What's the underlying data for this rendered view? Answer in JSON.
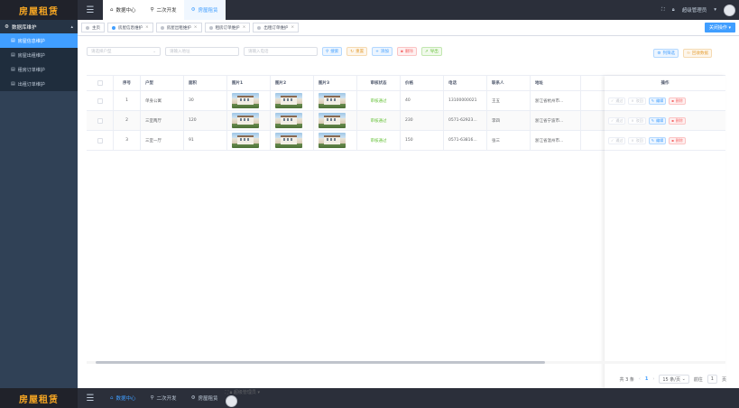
{
  "app": {
    "logo": "房屋租赁",
    "accent": "#409eff"
  },
  "topnav": {
    "tabs": [
      {
        "label": "数据中心",
        "icon": "home-icon"
      },
      {
        "label": "二次开发",
        "icon": "location-icon"
      },
      {
        "label": "房屋租赁",
        "icon": "gear-icon"
      }
    ],
    "user": "超级管理员"
  },
  "sidebar": {
    "group": "数据库维护",
    "items": [
      {
        "label": "房屋信息维护"
      },
      {
        "label": "房屋出租维护"
      },
      {
        "label": "租房订单维护"
      },
      {
        "label": "出租订单维护"
      }
    ]
  },
  "tags": {
    "items": [
      {
        "label": "主页"
      },
      {
        "label": "房屋信息维护"
      },
      {
        "label": "房屋出租维护"
      },
      {
        "label": "租房订单维护"
      },
      {
        "label": "出租订单维护"
      }
    ],
    "ops_label": "关闭操作"
  },
  "search": {
    "type_placeholder": "请选择户型",
    "address_placeholder": "请输入地址",
    "phone_placeholder": "请输入电话",
    "search_label": "搜索",
    "reset_label": "重置",
    "add_label": "添加",
    "delete_label": "删除",
    "export_label": "导出",
    "columns_label": "列筛选",
    "recycle_label": "回收数据"
  },
  "table": {
    "headers": [
      "序号",
      "户型",
      "面积",
      "图片1",
      "图片2",
      "图片3",
      "审核状态",
      "价格",
      "电话",
      "联系人",
      "地址"
    ],
    "ops_header": "操作",
    "rows": [
      {
        "index": "1",
        "type": "单身公寓",
        "area": "30",
        "status": "审核通过",
        "price": "40",
        "phone": "13100000021",
        "contact": "王五",
        "address": "浙江省杭州市..."
      },
      {
        "index": "2",
        "type": "三室两厅",
        "area": "120",
        "status": "审核通过",
        "price": "230",
        "phone": "0571-62923...",
        "contact": "李四",
        "address": "浙江省宁波市..."
      },
      {
        "index": "3",
        "type": "三室一厅",
        "area": "91",
        "status": "审核通过",
        "price": "150",
        "phone": "0571-63816...",
        "contact": "张三",
        "address": "浙江省温州市..."
      }
    ],
    "op_buttons": [
      "通过",
      "驳回",
      "编辑",
      "删除"
    ]
  },
  "pager": {
    "total": "共 3 条",
    "page_size": "15 条/页",
    "goto": "前往",
    "page": "1",
    "page_unit": "页"
  }
}
